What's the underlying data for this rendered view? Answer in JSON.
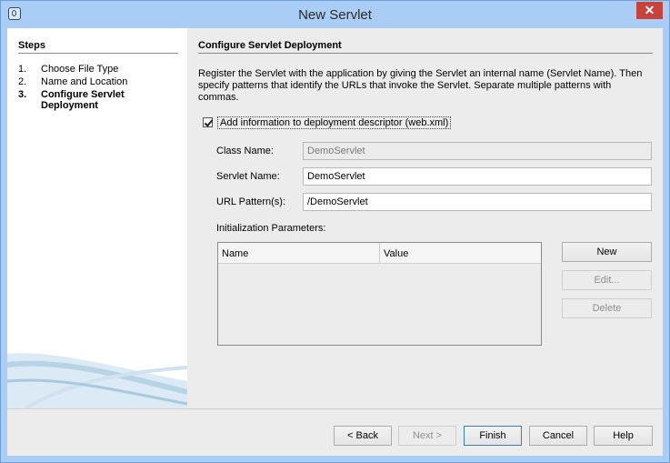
{
  "window": {
    "title": "New Servlet",
    "close_glyph": "✕"
  },
  "steps": {
    "heading": "Steps",
    "items": [
      {
        "num": "1.",
        "label": "Choose File Type"
      },
      {
        "num": "2.",
        "label": "Name and Location"
      },
      {
        "num": "3.",
        "label": "Configure Servlet Deployment"
      }
    ]
  },
  "panel": {
    "title": "Configure Servlet Deployment",
    "description": "Register the Servlet with the application by giving the Servlet an internal name (Servlet Name). Then specify patterns that identify the URLs that invoke the Servlet. Separate multiple patterns with commas.",
    "checkbox_label": "Add information to deployment descriptor (web.xml)",
    "checkbox_checked": true,
    "class_name_label": "Class Name:",
    "class_name_value": "DemoServlet",
    "servlet_name_label": "Servlet Name:",
    "servlet_name_value": "DemoServlet",
    "url_pattern_label": "URL Pattern(s):",
    "url_pattern_value": "/DemoServlet",
    "init_params_label": "Initialization Parameters:",
    "table_columns": [
      "Name",
      "Value"
    ],
    "new_button": "New",
    "edit_button": "Edit...",
    "delete_button": "Delete"
  },
  "footer": {
    "back": "< Back",
    "next": "Next >",
    "finish": "Finish",
    "cancel": "Cancel",
    "help": "Help"
  },
  "colors": {
    "title_bar": "#a9cdf5",
    "close_button": "#c7423a",
    "dialog_bg": "#ececec"
  }
}
